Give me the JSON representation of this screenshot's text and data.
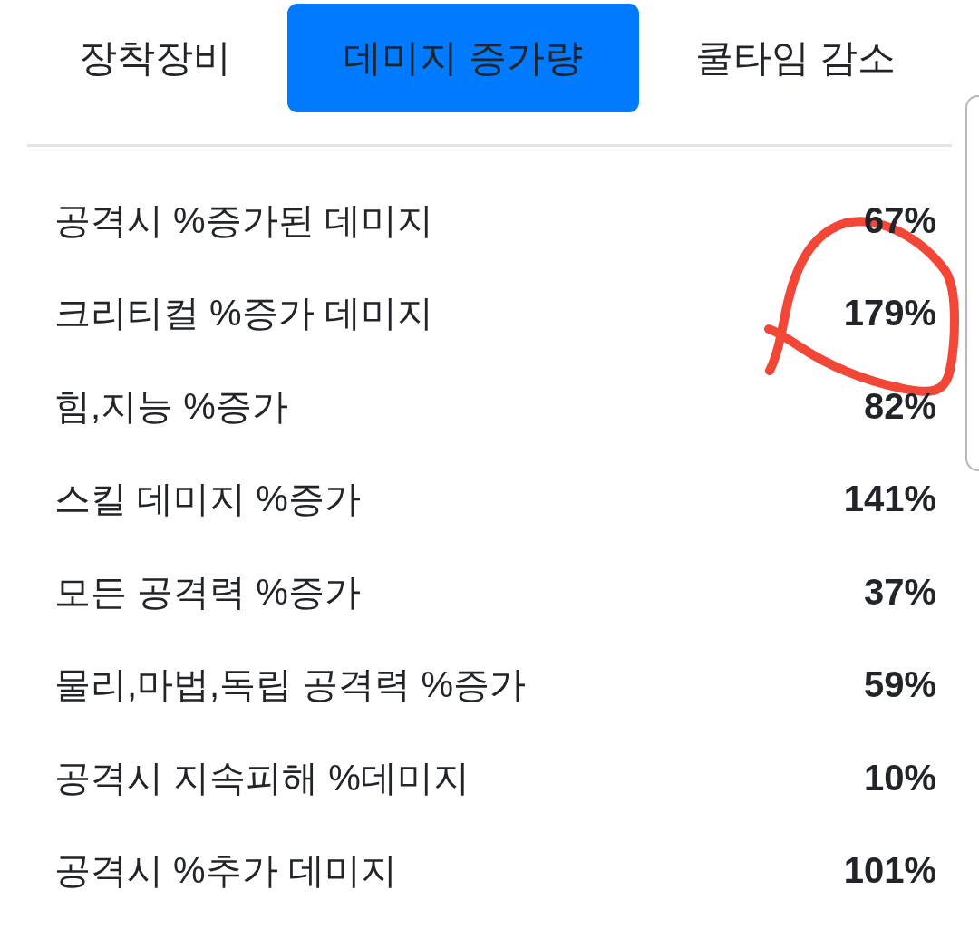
{
  "tabs": [
    {
      "label": "장착장비",
      "selected": false
    },
    {
      "label": "데미지 증가량",
      "selected": true
    },
    {
      "label": "쿨타임 감소",
      "selected": false
    }
  ],
  "stats": [
    {
      "label": "공격시 %증가된 데미지",
      "value": "67%",
      "circled": false
    },
    {
      "label": "크리티컬 %증가 데미지",
      "value": "179%",
      "circled": true
    },
    {
      "label": "힘,지능 %증가",
      "value": "82%",
      "circled": false
    },
    {
      "label": "스킬 데미지 %증가",
      "value": "141%",
      "circled": false
    },
    {
      "label": "모든 공격력 %증가",
      "value": "37%",
      "circled": false
    },
    {
      "label": "물리,마법,독립 공격력 %증가",
      "value": "59%",
      "circled": false
    },
    {
      "label": "공격시 지속피해 %데미지",
      "value": "10%",
      "circled": false
    },
    {
      "label": "공격시 %추가 데미지",
      "value": "101%",
      "circled": false
    }
  ]
}
